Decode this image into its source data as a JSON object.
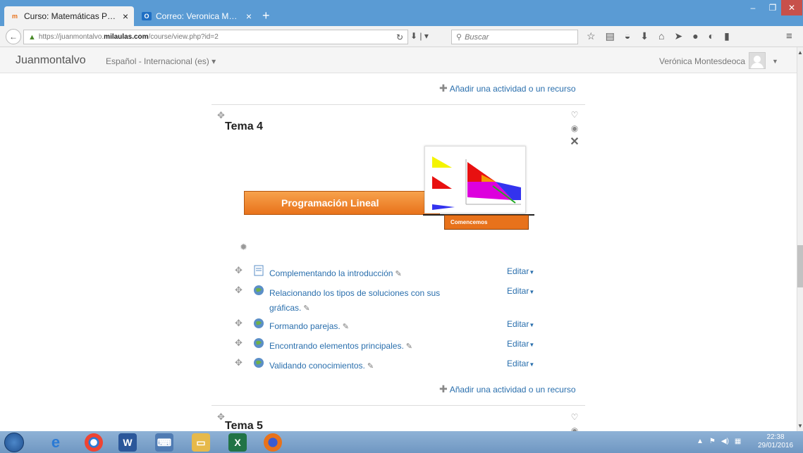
{
  "browser": {
    "tabs": [
      {
        "title": "Curso: Matemáticas Prime...",
        "favicon": "m"
      },
      {
        "title": "Correo: Veronica Montesd...",
        "favicon": "O"
      }
    ],
    "url_prefix": "https://juanmontalvo.",
    "url_domain": "milaulas.com",
    "url_suffix": "/course/view.php?id=2",
    "search_placeholder": "Buscar"
  },
  "header": {
    "brand": "Juanmontalvo",
    "language": "Español - Internacional (es) ▾",
    "user_name": "Verónica Montesdeoca"
  },
  "course": {
    "add_activity_label": "Añadir una actividad o un recurso",
    "sections": [
      {
        "title": "Tema 4",
        "banner": {
          "title": "Programación Lineal",
          "button": "Comencemos"
        },
        "activities": [
          {
            "title": "Complementando la introducción",
            "type": "page",
            "edit": "Editar"
          },
          {
            "title": "Relacionando los tipos de soluciones con sus gráficas.",
            "type": "url",
            "edit": "Editar"
          },
          {
            "title": "Formando parejas.",
            "type": "url",
            "edit": "Editar"
          },
          {
            "title": "Encontrando elementos principales.",
            "type": "url",
            "edit": "Editar"
          },
          {
            "title": "Validando conocimientos.",
            "type": "url",
            "edit": "Editar"
          }
        ]
      },
      {
        "title": "Tema 5"
      }
    ]
  },
  "taskbar": {
    "time": "22:38",
    "date": "29/01/2016"
  },
  "colors": {
    "link": "#2a6fad",
    "banner_orange": "#e8721b",
    "tab_strip": "#5a9bd4"
  }
}
